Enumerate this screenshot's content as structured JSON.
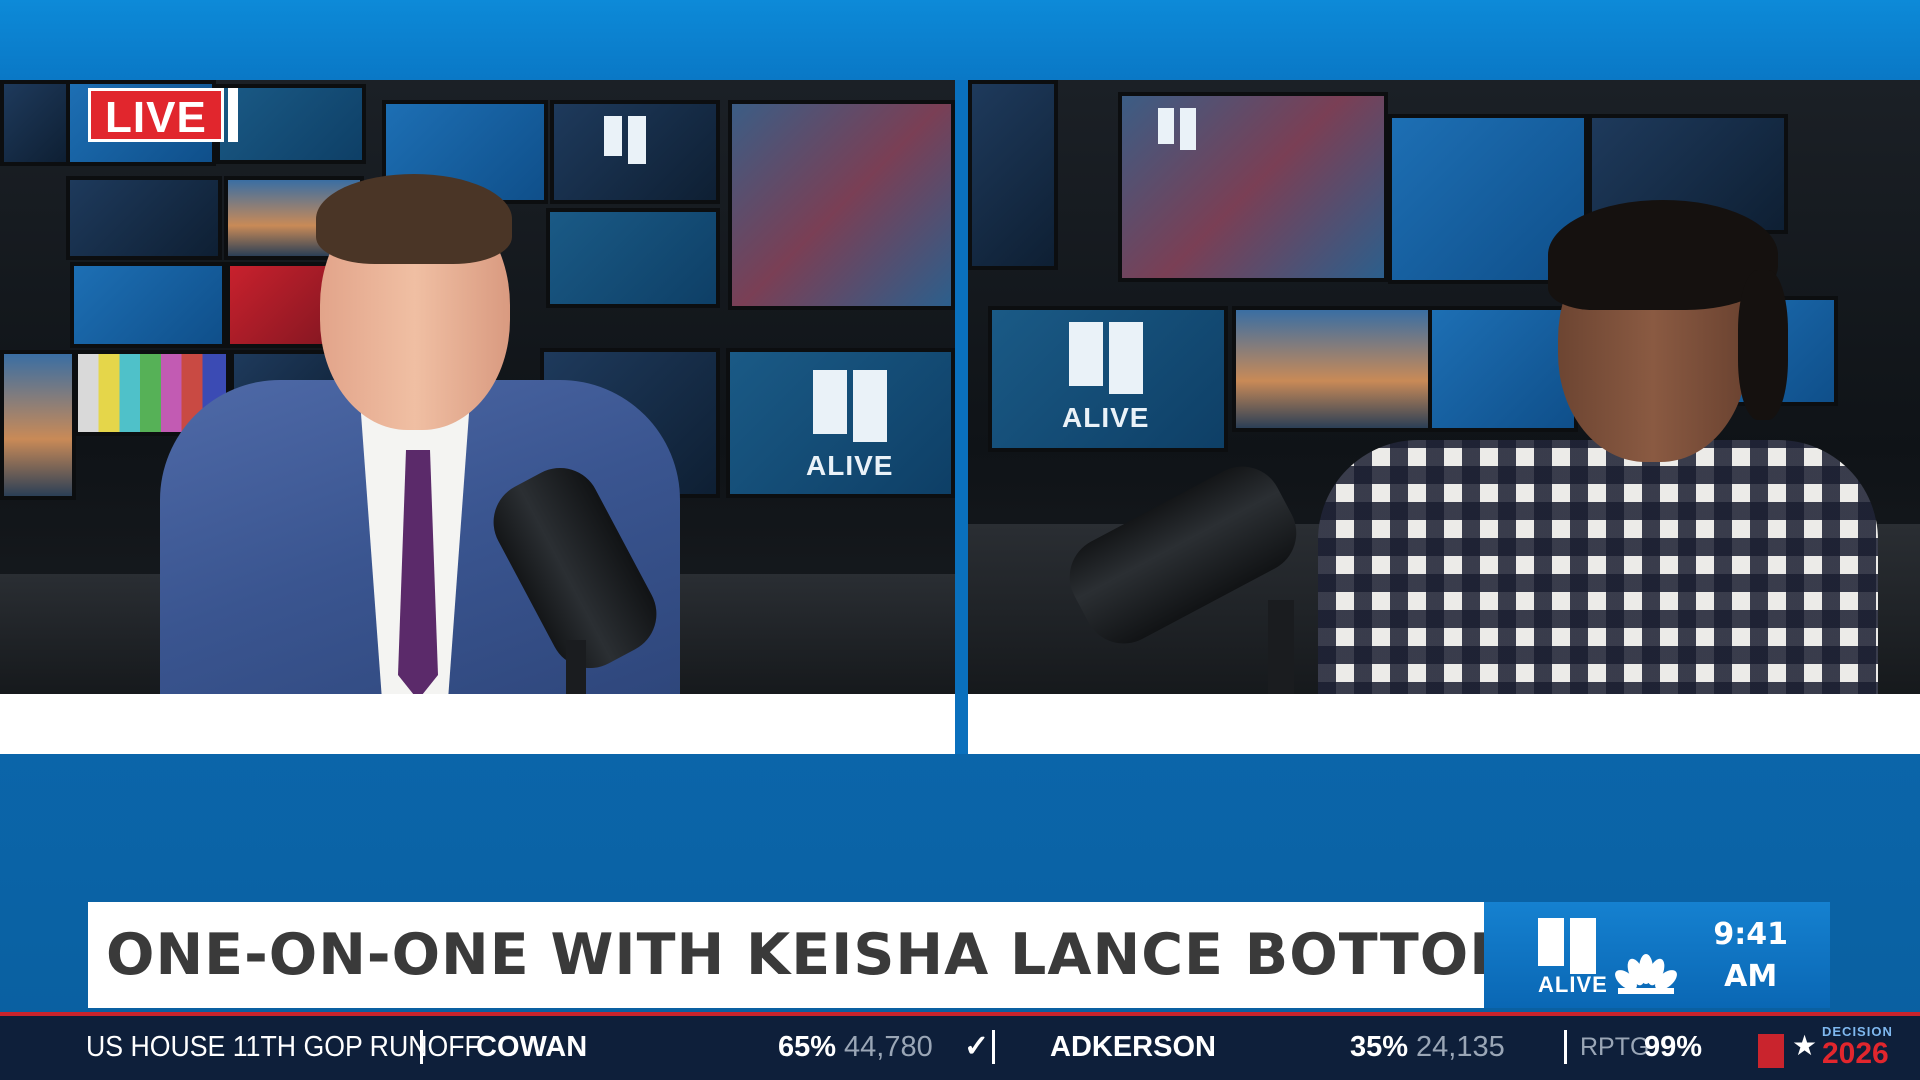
{
  "live_bug": {
    "label": "LIVE"
  },
  "lower_third": {
    "headline": "ONE-ON-ONE WITH KEISHA LANCE BOTTOMS",
    "station_logo_text": "ALIVE",
    "time": "9:41",
    "ampm": "AM"
  },
  "studio": {
    "monitor_labels": [
      "ALIVE",
      "ALIVE"
    ]
  },
  "ticker": {
    "race": "US HOUSE 11TH GOP RUNOFF",
    "candidates": [
      {
        "name": "COWAN",
        "percent": "65%",
        "votes": "44,780",
        "winner": true
      },
      {
        "name": "ADKERSON",
        "percent": "35%",
        "votes": "24,135",
        "winner": false
      }
    ],
    "reporting_label": "RPTG",
    "reporting_value": "99%",
    "check_mark": "✓",
    "decision_brand": "DECISION",
    "decision_year": "2026"
  },
  "colors": {
    "brand_blue": "#0a74c0",
    "live_red": "#e1262d",
    "ticker_navy": "#0e1f3a",
    "ticker_accent_red": "#c9242d"
  }
}
